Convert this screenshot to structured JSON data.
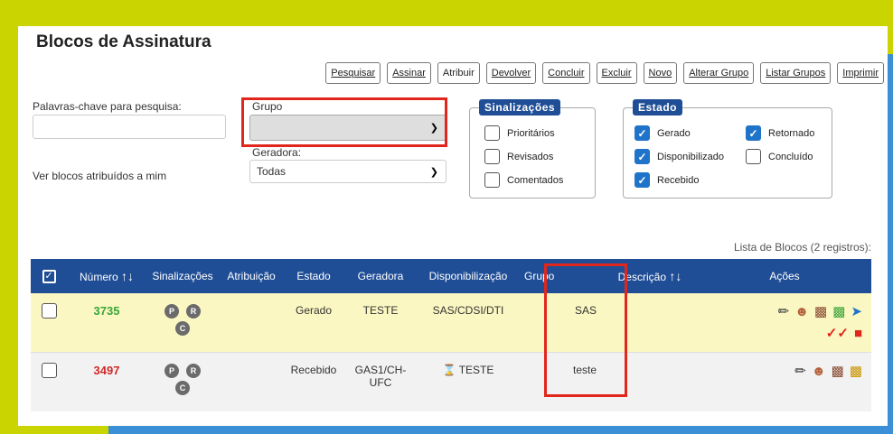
{
  "page_title": "Blocos de Assinatura",
  "toolbar": [
    "Pesquisar",
    "Assinar",
    "Atribuir",
    "Devolver",
    "Concluir",
    "Excluir",
    "Novo",
    "Alterar Grupo",
    "Listar Grupos",
    "Imprimir"
  ],
  "filters": {
    "keywords_label": "Palavras-chave para pesquisa:",
    "keywords_value": "",
    "assigned_label": "Ver blocos atribuídos a mim",
    "grupo_label": "Grupo",
    "grupo_value": "",
    "geradora_label": "Geradora:",
    "geradora_value": "Todas"
  },
  "sinalizacoes": {
    "title": "Sinalizações",
    "items": [
      {
        "label": "Prioritários",
        "checked": false
      },
      {
        "label": "Revisados",
        "checked": false
      },
      {
        "label": "Comentados",
        "checked": false
      }
    ]
  },
  "estado": {
    "title": "Estado",
    "items": [
      {
        "label": "Gerado",
        "checked": true
      },
      {
        "label": "Retornado",
        "checked": true
      },
      {
        "label": "Disponibilizado",
        "checked": true
      },
      {
        "label": "Concluído",
        "checked": false
      },
      {
        "label": "Recebido",
        "checked": true
      }
    ]
  },
  "list_count": "Lista de Blocos (2 registros):",
  "table": {
    "headers": {
      "numero": "Número",
      "sinalizacoes": "Sinalizações",
      "atribuicao": "Atribuição",
      "estado": "Estado",
      "geradora": "Geradora",
      "disponibilizacao": "Disponibilização",
      "grupo": "Grupo",
      "descricao": "Descrição",
      "acoes": "Ações"
    },
    "rows": [
      {
        "numero": "3735",
        "estado": "Gerado",
        "geradora": "TESTE",
        "disponibilizacao": "SAS/CDSI/DTI",
        "grupo": "SAS",
        "descricao": ""
      },
      {
        "numero": "3497",
        "estado": "Recebido",
        "geradora": "GAS1/CH-UFC",
        "disponibilizacao": "TESTE",
        "grupo": "teste",
        "descricao": ""
      }
    ],
    "sig_badges": [
      "P",
      "R",
      "C"
    ]
  },
  "colors": {
    "frame_green": "#c9d400",
    "frame_blue": "#3a8fd6",
    "header_blue": "#1f4e96",
    "highlight_red": "#e1261c",
    "row_yellow": "#fbf7c2"
  }
}
